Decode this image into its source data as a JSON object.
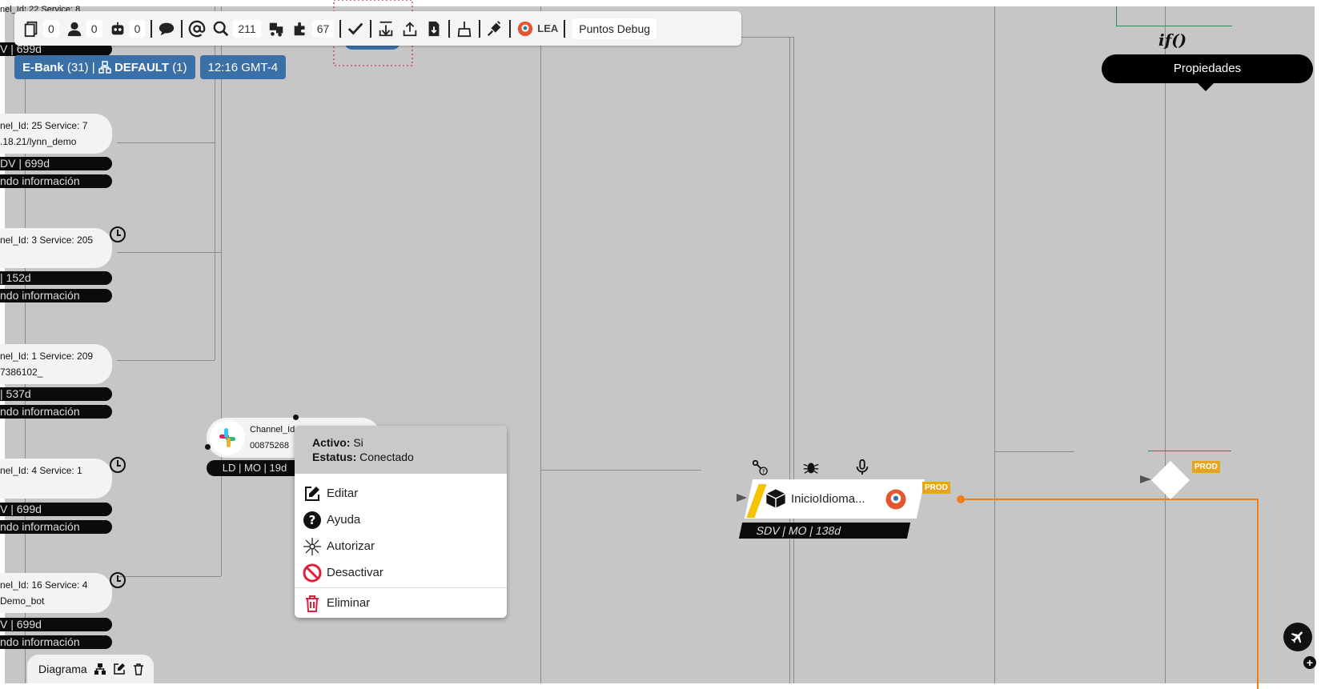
{
  "toolbar": {
    "items": [
      {
        "icon": "documents-icon",
        "count": "0"
      },
      {
        "icon": "agent-icon",
        "count": "0"
      },
      {
        "icon": "robot-icon",
        "count": "0"
      },
      {
        "icon": "chat-bubble-icon"
      },
      {
        "icon": "at-sign-icon"
      },
      {
        "icon": "search-icon",
        "count": "211"
      },
      {
        "icon": "trucks-icon"
      },
      {
        "icon": "puzzle-icon",
        "count": "67"
      },
      {
        "icon": "check-icon"
      },
      {
        "icon": "download-to-line-icon"
      },
      {
        "icon": "upload-icon"
      },
      {
        "icon": "file-download-icon"
      },
      {
        "icon": "broom-icon"
      },
      {
        "icon": "plug-icon"
      }
    ],
    "lea_label": "LEA",
    "debug_label": "Puntos Debug"
  },
  "badges": {
    "bank_name": "E-Bank",
    "bank_count": "(31)",
    "default_label": "DEFAULT",
    "default_count": "(1)",
    "time": "12:16 GMT-4"
  },
  "tooltip": "Propiedades",
  "if_label": "if()",
  "channels": [
    {
      "line1": "nel_Id: 22 Service: 8",
      "line2": "",
      "pill1": "V | 699d",
      "pill2": ""
    },
    {
      "line1": "nel_Id: 25 Service: 7",
      "line2": ".18.21/lynn_demo",
      "pill1": "DV | 699d",
      "pill2": "ndo información"
    },
    {
      "line1": "nel_Id: 3 Service: 205",
      "line2": "",
      "pill1": "| 152d",
      "pill2": "ndo información"
    },
    {
      "line1": "nel_Id: 1 Service: 209",
      "line2": "7386102_",
      "pill1": "| 537d",
      "pill2": "ndo información"
    },
    {
      "line1": "nel_Id: 4 Service: 1",
      "line2": "",
      "pill1": "V | 699d",
      "pill2": "ndo información"
    },
    {
      "line1": "nel_Id: 16 Service: 4",
      "line2": "Demo_bot",
      "pill1": "V | 699d",
      "pill2": "ndo información"
    }
  ],
  "slack_node": {
    "line1": "Channel_Id",
    "line2": "00875268",
    "pill": "LD | MO | 19d"
  },
  "context_menu": {
    "activo_label": "Activo:",
    "activo_value": "Si",
    "estatus_label": "Estatus:",
    "estatus_value": "Conectado",
    "items": [
      "Editar",
      "Ayuda",
      "Autorizar",
      "Desactivar",
      "Eliminar"
    ]
  },
  "inicio_node": {
    "label": "InicioIdioma...",
    "pill": "SDV | MO | 138d",
    "tag": "PROD"
  },
  "diamond_tag": "PROD",
  "diagram_tab": {
    "label": "Diagrama"
  },
  "colors": {
    "canvas": "#c6c6c6",
    "badge": "#3b6fa8",
    "prod": "#e5a521",
    "connector": "#f07d1d",
    "green_line": "#2e8b57"
  }
}
